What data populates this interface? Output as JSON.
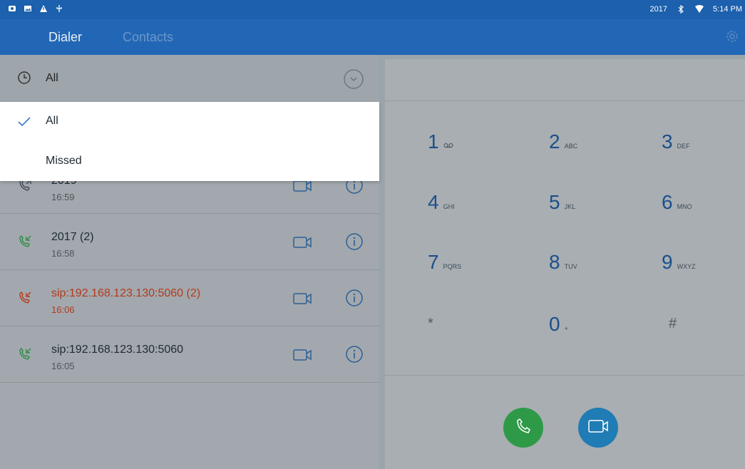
{
  "status_bar": {
    "left_icons": [
      "sim-icon",
      "image-icon",
      "warning-icon",
      "usb-icon"
    ],
    "right_text": "2017",
    "time": "5:14 PM"
  },
  "app_bar": {
    "tabs": [
      {
        "label": "Dialer"
      },
      {
        "label": "Contacts"
      }
    ]
  },
  "filter": {
    "selected": "All"
  },
  "dropdown": {
    "items": [
      {
        "label": "All"
      },
      {
        "label": "Missed"
      }
    ]
  },
  "call_log": [
    {
      "name": "2019",
      "time": "16:59",
      "type": "outgoing"
    },
    {
      "name": "2017 (2)",
      "time": "16:58",
      "type": "incoming"
    },
    {
      "name": "sip:192.168.123.130:5060 (2)",
      "time": "16:06",
      "type": "missed"
    },
    {
      "name": "sip:192.168.123.130:5060",
      "time": "16:05",
      "type": "incoming"
    }
  ],
  "keypad": [
    {
      "digit": "1",
      "letters": "ᴼᴼ"
    },
    {
      "digit": "2",
      "letters": "ABC"
    },
    {
      "digit": "3",
      "letters": "DEF"
    },
    {
      "digit": "4",
      "letters": "GHI"
    },
    {
      "digit": "5",
      "letters": "JKL"
    },
    {
      "digit": "6",
      "letters": "MNO"
    },
    {
      "digit": "7",
      "letters": "PQRS"
    },
    {
      "digit": "8",
      "letters": "TUV"
    },
    {
      "digit": "9",
      "letters": "WXYZ"
    },
    {
      "digit": "*",
      "letters": ""
    },
    {
      "digit": "0",
      "letters": "+"
    },
    {
      "digit": "#",
      "letters": ""
    }
  ],
  "colors": {
    "accent": "#2267b6",
    "missed": "#b33a1e",
    "voice_call": "#2e9a48",
    "video_call": "#1f7cb4"
  }
}
